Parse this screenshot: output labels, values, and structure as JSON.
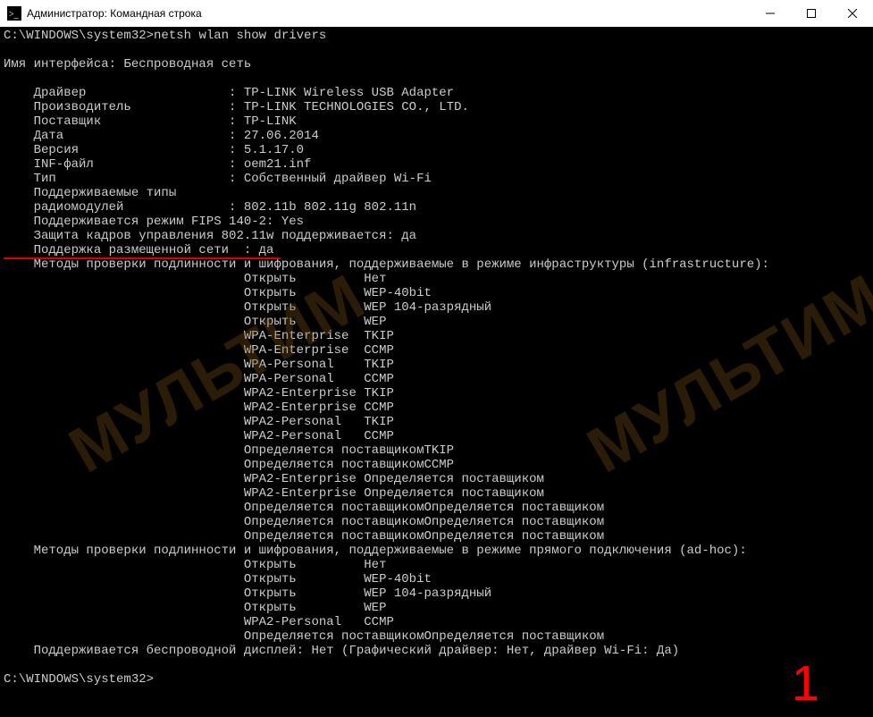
{
  "window": {
    "title": "Администратор: Командная строка"
  },
  "prompt1": "C:\\WINDOWS\\system32>",
  "command": "netsh wlan show drivers",
  "blank": "",
  "interface_line": "Имя интерфейса: Беспроводная сеть",
  "fields": {
    "driver": "    Драйвер                   : TP-LINK Wireless USB Adapter",
    "vendor": "    Производитель             : TP-LINK TECHNOLOGIES CO., LTD.",
    "provider": "    Поставщик                 : TP-LINK",
    "date": "    Дата                      : 27.06.2014",
    "version": "    Версия                    : 5.1.17.0",
    "inf": "    INF-файл                  : oem21.inf",
    "type": "    Тип                       : Собственный драйвер Wi-Fi",
    "radios1": "    Поддерживаемые типы",
    "radios2": "    радиомодулей              : 802.11b 802.11g 802.11n",
    "fips": "    Поддерживается режим FIPS 140-2: Yes",
    "mgmtframe": "    Защита кадров управления 802.11w поддерживается: да",
    "hostednet": "    Поддержка размещенной сети  : да",
    "infra_hdr": "    Методы проверки подлинности и шифрования, поддерживаемые в режиме инфраструктуры (infrastructure):"
  },
  "infra": [
    "                                Открыть         Нет",
    "                                Открыть         WEP-40bit",
    "                                Открыть         WEP 104-разрядный",
    "                                Открыть         WEP",
    "                                WPA-Enterprise  TKIP",
    "                                WPA-Enterprise  CCMP",
    "                                WPA-Personal    TKIP",
    "                                WPA-Personal    CCMP",
    "                                WPA2-Enterprise TKIP",
    "                                WPA2-Enterprise CCMP",
    "                                WPA2-Personal   TKIP",
    "                                WPA2-Personal   CCMP",
    "                                Определяется поставщикомTKIP",
    "                                Определяется поставщикомCCMP",
    "                                WPA2-Enterprise Определяется поставщиком",
    "                                WPA2-Enterprise Определяется поставщиком",
    "                                Определяется поставщикомОпределяется поставщиком",
    "                                Определяется поставщикомОпределяется поставщиком",
    "                                Определяется поставщикомОпределяется поставщиком"
  ],
  "adhoc_hdr": "    Методы проверки подлинности и шифрования, поддерживаемые в режиме прямого подключения (ad-hoc):",
  "adhoc": [
    "                                Открыть         Нет",
    "                                Открыть         WEP-40bit",
    "                                Открыть         WEP 104-разрядный",
    "                                Открыть         WEP",
    "                                WPA2-Personal   CCMP",
    "                                Определяется поставщикомОпределяется поставщиком"
  ],
  "wireless_display": "    Поддерживается беспроводной дисплей: Нет (Графический драйвер: Нет, драйвер Wi-Fi: Да)",
  "prompt2": "C:\\WINDOWS\\system32>",
  "watermark_text": "МУЛЬТИМ",
  "step_number": "1"
}
